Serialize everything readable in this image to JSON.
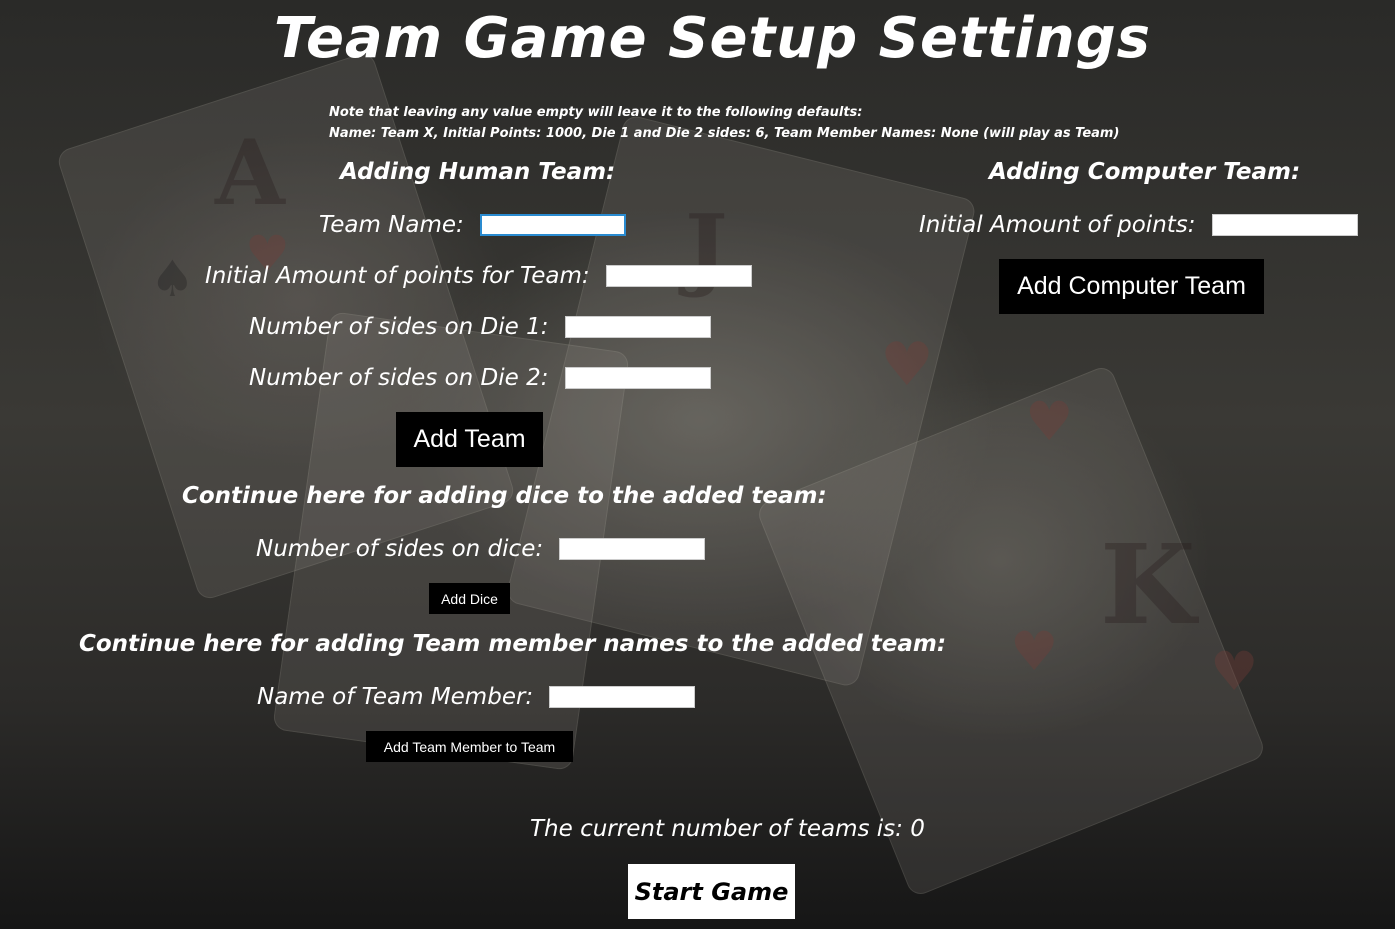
{
  "title": "Team Game Setup Settings",
  "note": {
    "line1": "Note that leaving any value empty will leave it to the following defaults:",
    "line2": "Name: Team X, Initial Points: 1000, Die 1 and Die 2 sides: 6, Team Member Names: None (will play as Team)"
  },
  "human": {
    "heading": "Adding Human Team:",
    "team_name_label": "Team Name:",
    "team_name_value": "",
    "points_label": "Initial Amount of points for Team:",
    "points_value": "",
    "die1_label": "Number of sides on Die 1:",
    "die1_value": "",
    "die2_label": "Number of sides on Die 2:",
    "die2_value": "",
    "add_button": "Add Team"
  },
  "computer": {
    "heading": "Adding Computer Team:",
    "points_label": "Initial Amount of points:",
    "points_value": "",
    "add_button": "Add Computer Team"
  },
  "dice": {
    "heading": "Continue here for adding dice to the added team:",
    "sides_label": "Number of sides on dice:",
    "sides_value": "",
    "add_button": "Add Dice"
  },
  "members": {
    "heading": "Continue here for adding Team member names to the added team:",
    "name_label": "Name of Team Member:",
    "name_value": "",
    "add_button": "Add Team Member to Team"
  },
  "status": {
    "count_text": "The current number of teams is: 0"
  },
  "start_button": "Start Game",
  "colors": {
    "button_bg": "#000000",
    "focus_border": "#2a8bd0",
    "text": "#ffffff"
  }
}
